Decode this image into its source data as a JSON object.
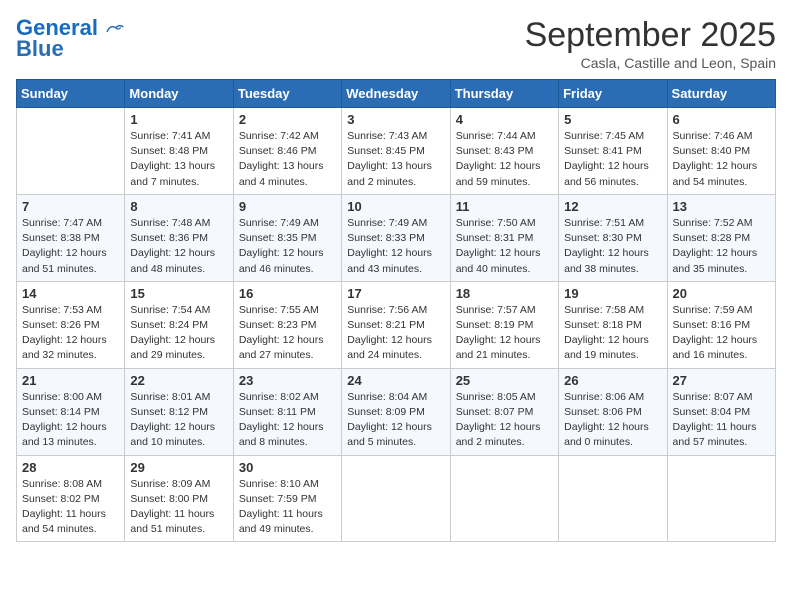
{
  "header": {
    "logo_line1": "General",
    "logo_line2": "Blue",
    "month_title": "September 2025",
    "location": "Casla, Castille and Leon, Spain"
  },
  "weekdays": [
    "Sunday",
    "Monday",
    "Tuesday",
    "Wednesday",
    "Thursday",
    "Friday",
    "Saturday"
  ],
  "weeks": [
    [
      {
        "day": "",
        "info": ""
      },
      {
        "day": "1",
        "info": "Sunrise: 7:41 AM\nSunset: 8:48 PM\nDaylight: 13 hours\nand 7 minutes."
      },
      {
        "day": "2",
        "info": "Sunrise: 7:42 AM\nSunset: 8:46 PM\nDaylight: 13 hours\nand 4 minutes."
      },
      {
        "day": "3",
        "info": "Sunrise: 7:43 AM\nSunset: 8:45 PM\nDaylight: 13 hours\nand 2 minutes."
      },
      {
        "day": "4",
        "info": "Sunrise: 7:44 AM\nSunset: 8:43 PM\nDaylight: 12 hours\nand 59 minutes."
      },
      {
        "day": "5",
        "info": "Sunrise: 7:45 AM\nSunset: 8:41 PM\nDaylight: 12 hours\nand 56 minutes."
      },
      {
        "day": "6",
        "info": "Sunrise: 7:46 AM\nSunset: 8:40 PM\nDaylight: 12 hours\nand 54 minutes."
      }
    ],
    [
      {
        "day": "7",
        "info": "Sunrise: 7:47 AM\nSunset: 8:38 PM\nDaylight: 12 hours\nand 51 minutes."
      },
      {
        "day": "8",
        "info": "Sunrise: 7:48 AM\nSunset: 8:36 PM\nDaylight: 12 hours\nand 48 minutes."
      },
      {
        "day": "9",
        "info": "Sunrise: 7:49 AM\nSunset: 8:35 PM\nDaylight: 12 hours\nand 46 minutes."
      },
      {
        "day": "10",
        "info": "Sunrise: 7:49 AM\nSunset: 8:33 PM\nDaylight: 12 hours\nand 43 minutes."
      },
      {
        "day": "11",
        "info": "Sunrise: 7:50 AM\nSunset: 8:31 PM\nDaylight: 12 hours\nand 40 minutes."
      },
      {
        "day": "12",
        "info": "Sunrise: 7:51 AM\nSunset: 8:30 PM\nDaylight: 12 hours\nand 38 minutes."
      },
      {
        "day": "13",
        "info": "Sunrise: 7:52 AM\nSunset: 8:28 PM\nDaylight: 12 hours\nand 35 minutes."
      }
    ],
    [
      {
        "day": "14",
        "info": "Sunrise: 7:53 AM\nSunset: 8:26 PM\nDaylight: 12 hours\nand 32 minutes."
      },
      {
        "day": "15",
        "info": "Sunrise: 7:54 AM\nSunset: 8:24 PM\nDaylight: 12 hours\nand 29 minutes."
      },
      {
        "day": "16",
        "info": "Sunrise: 7:55 AM\nSunset: 8:23 PM\nDaylight: 12 hours\nand 27 minutes."
      },
      {
        "day": "17",
        "info": "Sunrise: 7:56 AM\nSunset: 8:21 PM\nDaylight: 12 hours\nand 24 minutes."
      },
      {
        "day": "18",
        "info": "Sunrise: 7:57 AM\nSunset: 8:19 PM\nDaylight: 12 hours\nand 21 minutes."
      },
      {
        "day": "19",
        "info": "Sunrise: 7:58 AM\nSunset: 8:18 PM\nDaylight: 12 hours\nand 19 minutes."
      },
      {
        "day": "20",
        "info": "Sunrise: 7:59 AM\nSunset: 8:16 PM\nDaylight: 12 hours\nand 16 minutes."
      }
    ],
    [
      {
        "day": "21",
        "info": "Sunrise: 8:00 AM\nSunset: 8:14 PM\nDaylight: 12 hours\nand 13 minutes."
      },
      {
        "day": "22",
        "info": "Sunrise: 8:01 AM\nSunset: 8:12 PM\nDaylight: 12 hours\nand 10 minutes."
      },
      {
        "day": "23",
        "info": "Sunrise: 8:02 AM\nSunset: 8:11 PM\nDaylight: 12 hours\nand 8 minutes."
      },
      {
        "day": "24",
        "info": "Sunrise: 8:04 AM\nSunset: 8:09 PM\nDaylight: 12 hours\nand 5 minutes."
      },
      {
        "day": "25",
        "info": "Sunrise: 8:05 AM\nSunset: 8:07 PM\nDaylight: 12 hours\nand 2 minutes."
      },
      {
        "day": "26",
        "info": "Sunrise: 8:06 AM\nSunset: 8:06 PM\nDaylight: 12 hours\nand 0 minutes."
      },
      {
        "day": "27",
        "info": "Sunrise: 8:07 AM\nSunset: 8:04 PM\nDaylight: 11 hours\nand 57 minutes."
      }
    ],
    [
      {
        "day": "28",
        "info": "Sunrise: 8:08 AM\nSunset: 8:02 PM\nDaylight: 11 hours\nand 54 minutes."
      },
      {
        "day": "29",
        "info": "Sunrise: 8:09 AM\nSunset: 8:00 PM\nDaylight: 11 hours\nand 51 minutes."
      },
      {
        "day": "30",
        "info": "Sunrise: 8:10 AM\nSunset: 7:59 PM\nDaylight: 11 hours\nand 49 minutes."
      },
      {
        "day": "",
        "info": ""
      },
      {
        "day": "",
        "info": ""
      },
      {
        "day": "",
        "info": ""
      },
      {
        "day": "",
        "info": ""
      }
    ]
  ]
}
